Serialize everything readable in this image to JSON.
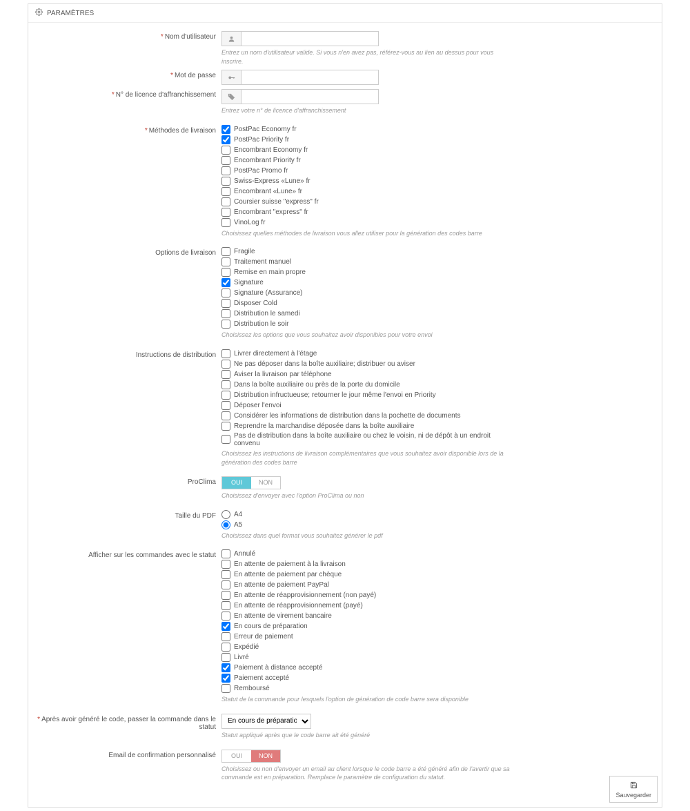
{
  "panel": {
    "title": "PARAMÈTRES"
  },
  "username": {
    "label": "Nom d'utilisateur",
    "value": "",
    "help": "Entrez un nom d'utilisateur valide. Si vous n'en avez pas, référez-vous au lien au dessus pour vous inscrire."
  },
  "password": {
    "label": "Mot de passe",
    "value": ""
  },
  "license": {
    "label": "N° de licence d'affranchissement",
    "value": "",
    "help": "Entrez votre n° de licence d'affranchissement"
  },
  "methods": {
    "label": "Méthodes de livraison",
    "items": [
      {
        "label": "PostPac Economy fr",
        "checked": true
      },
      {
        "label": "PostPac Priority fr",
        "checked": true
      },
      {
        "label": "Encombrant Economy fr",
        "checked": false
      },
      {
        "label": "Encombrant Priority fr",
        "checked": false
      },
      {
        "label": "PostPac Promo fr",
        "checked": false
      },
      {
        "label": "Swiss-Express «Lune» fr",
        "checked": false
      },
      {
        "label": "Encombrant «Lune» fr",
        "checked": false
      },
      {
        "label": "Coursier suisse \"express\" fr",
        "checked": false
      },
      {
        "label": "Encombrant \"express\" fr",
        "checked": false
      },
      {
        "label": "VinoLog fr",
        "checked": false
      }
    ],
    "help": "Choisissez quelles méthodes de livraison vous allez utiliser pour la génération des codes barre"
  },
  "options": {
    "label": "Options de livraison",
    "items": [
      {
        "label": "Fragile",
        "checked": false
      },
      {
        "label": "Traitement manuel",
        "checked": false
      },
      {
        "label": "Remise en main propre",
        "checked": false
      },
      {
        "label": "Signature",
        "checked": true
      },
      {
        "label": "Signature (Assurance)",
        "checked": false
      },
      {
        "label": "Disposer Cold",
        "checked": false
      },
      {
        "label": "Distribution le samedi",
        "checked": false
      },
      {
        "label": "Distribution le soir",
        "checked": false
      }
    ],
    "help": "Choisissez les options que vous souhaitez avoir disponibles pour votre envoi"
  },
  "instructions": {
    "label": "Instructions de distribution",
    "items": [
      {
        "label": "Livrer directement à l'étage",
        "checked": false
      },
      {
        "label": "Ne pas déposer dans la boîte auxiliaire; distribuer ou aviser",
        "checked": false
      },
      {
        "label": "Aviser la livraison par téléphone",
        "checked": false
      },
      {
        "label": "Dans la boîte auxiliaire ou près de la porte du domicile",
        "checked": false
      },
      {
        "label": "Distribution infructueuse; retourner le jour même l'envoi en Priority",
        "checked": false
      },
      {
        "label": "Déposer l'envoi",
        "checked": false
      },
      {
        "label": "Considérer les informations de distribution dans la pochette de documents",
        "checked": false
      },
      {
        "label": "Reprendre la marchandise déposée dans la boîte auxiliaire",
        "checked": false
      },
      {
        "label": "Pas de distribution dans la boîte auxiliaire ou chez le voisin, ni de dépôt à un endroit convenu",
        "checked": false
      }
    ],
    "help": "Choisissez les instructions de livraison complémentaires que vous souhaitez avoir disponible lors de la génération des codes barre"
  },
  "proclima": {
    "label": "ProClima",
    "yes": "OUI",
    "no": "NON",
    "value": true,
    "help": "Choisissez d'envoyer avec l'option ProClima ou non"
  },
  "pdfsize": {
    "label": "Taille du PDF",
    "options": [
      {
        "label": "A4",
        "checked": false
      },
      {
        "label": "A5",
        "checked": true
      }
    ],
    "help": "Choisissez dans quel format vous souhaitez générer le pdf"
  },
  "statuses": {
    "label": "Afficher sur les commandes avec le statut",
    "items": [
      {
        "label": "Annulé",
        "checked": false
      },
      {
        "label": "En attente de paiement à la livraison",
        "checked": false
      },
      {
        "label": "En attente de paiement par chèque",
        "checked": false
      },
      {
        "label": "En attente de paiement PayPal",
        "checked": false
      },
      {
        "label": "En attente de réapprovisionnement (non payé)",
        "checked": false
      },
      {
        "label": "En attente de réapprovisionnement (payé)",
        "checked": false
      },
      {
        "label": "En attente de virement bancaire",
        "checked": false
      },
      {
        "label": "En cours de préparation",
        "checked": true
      },
      {
        "label": "Erreur de paiement",
        "checked": false
      },
      {
        "label": "Expédié",
        "checked": false
      },
      {
        "label": "Livré",
        "checked": false
      },
      {
        "label": "Paiement à distance accepté",
        "checked": true
      },
      {
        "label": "Paiement accepté",
        "checked": true
      },
      {
        "label": "Remboursé",
        "checked": false
      }
    ],
    "help": "Statut de la commande pour lesquels l'option de génération de code barre sera disponible"
  },
  "aftercode": {
    "label": "Après avoir généré le code, passer la commande dans le statut",
    "selected": "En cours de préparation",
    "help": "Statut appliqué après que le code barre ait été généré"
  },
  "email": {
    "label": "Email de confirmation personnalisé",
    "yes": "OUI",
    "no": "NON",
    "value": false,
    "help": "Choisissez ou non d'envoyer un email au client lorsque le code barre a été généré afin de l'avertir que sa commande est en préparation. Remplace le paramètre de configuration du statut."
  },
  "save": {
    "label": "Sauvegarder"
  }
}
